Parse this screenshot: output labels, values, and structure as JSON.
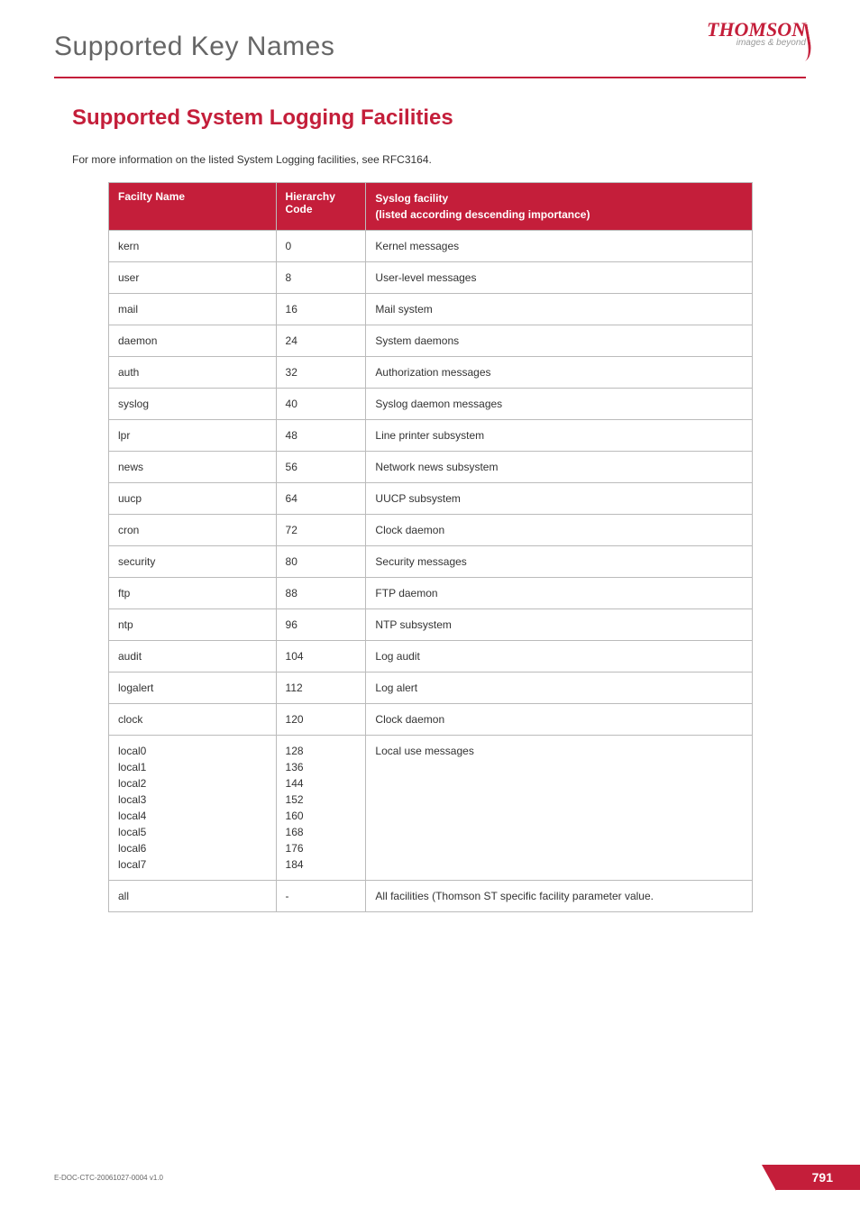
{
  "header": {
    "title": "Supported Key Names",
    "logo_text": "THOMSON",
    "logo_tag": "images & beyond"
  },
  "section": {
    "title": "Supported System Logging Facilities",
    "intro": "For more information on the listed System Logging facilities, see RFC3164."
  },
  "table": {
    "headers": {
      "name": "Facilty Name",
      "code": "Hierarchy Code",
      "desc": "Syslog facility\n(listed according descending importance)"
    },
    "rows": [
      {
        "name": "kern",
        "code": "0",
        "desc": "Kernel messages"
      },
      {
        "name": "user",
        "code": "8",
        "desc": "User-level messages"
      },
      {
        "name": "mail",
        "code": "16",
        "desc": "Mail system"
      },
      {
        "name": "daemon",
        "code": "24",
        "desc": "System daemons"
      },
      {
        "name": "auth",
        "code": "32",
        "desc": "Authorization messages"
      },
      {
        "name": "syslog",
        "code": "40",
        "desc": "Syslog daemon messages"
      },
      {
        "name": "lpr",
        "code": "48",
        "desc": "Line printer subsystem"
      },
      {
        "name": "news",
        "code": "56",
        "desc": "Network news subsystem"
      },
      {
        "name": "uucp",
        "code": "64",
        "desc": "UUCP subsystem"
      },
      {
        "name": "cron",
        "code": "72",
        "desc": "Clock daemon"
      },
      {
        "name": "security",
        "code": "80",
        "desc": "Security messages"
      },
      {
        "name": "ftp",
        "code": "88",
        "desc": "FTP daemon"
      },
      {
        "name": "ntp",
        "code": "96",
        "desc": "NTP subsystem"
      },
      {
        "name": "audit",
        "code": "104",
        "desc": "Log audit"
      },
      {
        "name": "logalert",
        "code": "112",
        "desc": "Log alert"
      },
      {
        "name": "clock",
        "code": "120",
        "desc": "Clock daemon"
      },
      {
        "name": "local0\nlocal1\nlocal2\nlocal3\nlocal4\nlocal5\nlocal6\nlocal7",
        "code": "128\n136\n144\n152\n160\n168\n176\n184",
        "desc": "Local use messages"
      },
      {
        "name": "all",
        "code": "-",
        "desc": "All facilities (Thomson ST specific facility parameter value."
      }
    ]
  },
  "footer": {
    "doc_id": "E-DOC-CTC-20061027-0004 v1.0",
    "page": "791"
  }
}
